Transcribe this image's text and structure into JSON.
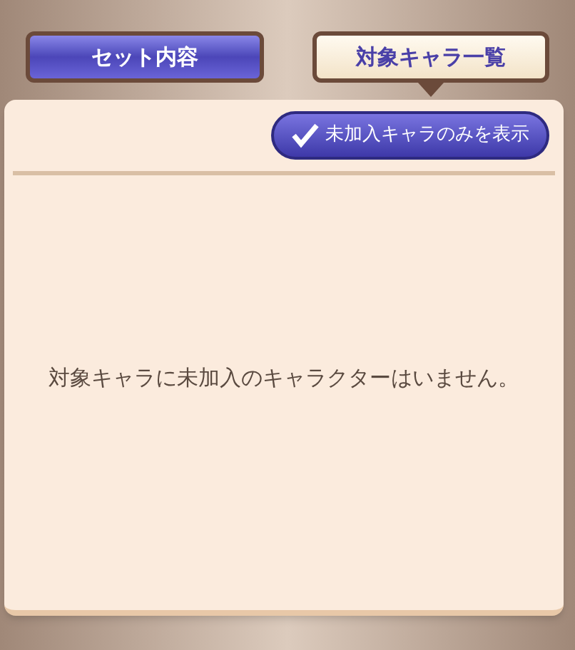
{
  "tabs": [
    {
      "label": "セット内容",
      "selected": false
    },
    {
      "label": "対象キャラ一覧",
      "selected": true
    }
  ],
  "filter_toggle": {
    "label": "未加入キャラのみを表示",
    "checked": true
  },
  "empty_message": "対象キャラに未加入のキャラクターはいません。"
}
